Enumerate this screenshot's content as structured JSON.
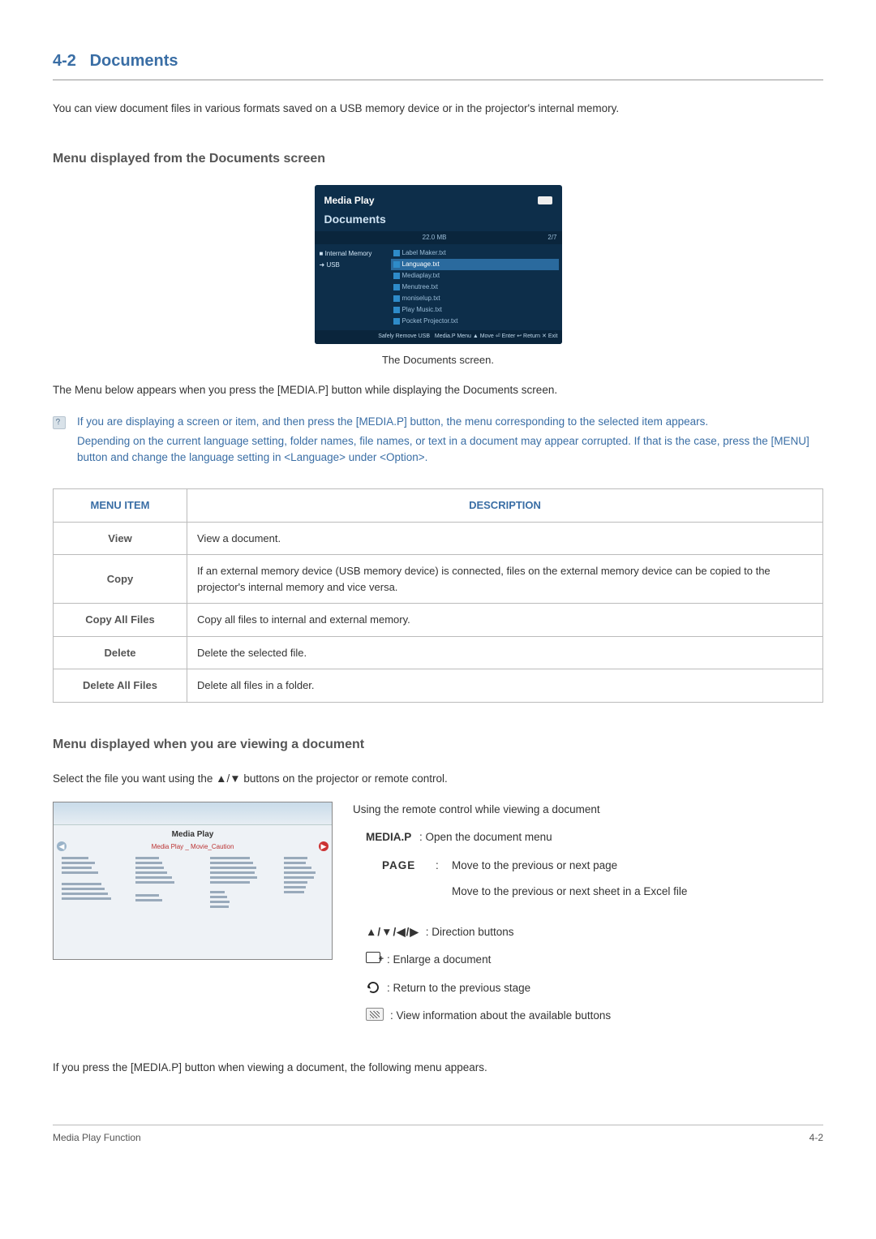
{
  "section": {
    "number": "4-2",
    "title": "Documents"
  },
  "intro": "You can view document files in various formats saved on a USB memory device or in the projector's internal memory.",
  "sub1": "Menu displayed from the Documents screen",
  "screenshot1": {
    "app_title": "Media Play",
    "section_title": "Documents",
    "storage": "22.0 MB",
    "page": "2/7",
    "sources": [
      "Internal Memory",
      "USB"
    ],
    "files": [
      "Label Maker.txt",
      "Language.txt",
      "Mediaplay.txt",
      "Menutree.txt",
      "moniselup.txt",
      "Play Music.txt",
      "Pocket Projector.txt"
    ],
    "footer_left": "Safely Remove USB",
    "footer_right": "Media.P Menu  ▲ Move  ⏎ Enter  ↩ Return  ✕ Exit"
  },
  "caption1": "The Documents screen.",
  "para_menu_appears": "The Menu below appears when you press the [MEDIA.P] button while displaying the Documents screen.",
  "note": {
    "line1": "If you are displaying a screen or item, and then press the [MEDIA.P] button, the menu corresponding to the selected item appears.",
    "line2": "Depending on the current language setting, folder names, file names, or text in a document may appear corrupted. If that is the case, press the [MENU] button and change the language setting in <Language> under <Option>."
  },
  "table": {
    "head_item": "MENU ITEM",
    "head_desc": "DESCRIPTION",
    "rows": [
      {
        "item": "View",
        "desc": "View a document."
      },
      {
        "item": "Copy",
        "desc": "If an external memory device (USB memory device) is connected, files on the external memory device can be copied to the projector's internal memory and vice versa."
      },
      {
        "item": "Copy All Files",
        "desc": "Copy all files to internal and external memory."
      },
      {
        "item": "Delete",
        "desc": "Delete the selected file."
      },
      {
        "item": "Delete All Files",
        "desc": "Delete all files in a folder."
      }
    ]
  },
  "sub2": "Menu displayed when you are viewing a document",
  "select_line": "Select the file you want using the ▲/▼ buttons on the projector or remote control.",
  "preview": {
    "title": "Media Play",
    "subtitle": "Media Play _ Movie_Caution",
    "bottom_left": "",
    "bottom_right": ""
  },
  "controls": {
    "heading": "Using the remote control while viewing a document",
    "mediap_label": "MEDIA.P",
    "mediap_text": ": Open the document menu",
    "page_label": "PAGE",
    "page_colon": ":",
    "page_text1": "Move to the previous or next page",
    "page_text2": "Move to the previous or next sheet in a Excel file",
    "dir_symbols": "▲/▼/◀/▶",
    "dir_text": ": Direction buttons",
    "enlarge_text": ": Enlarge a document",
    "return_text": ": Return to the previous stage",
    "info_text": ": View information about the available buttons"
  },
  "closing": "If you press the [MEDIA.P] button when viewing a document, the following menu appears.",
  "footer": {
    "left": "Media Play Function",
    "right": "4-2"
  }
}
